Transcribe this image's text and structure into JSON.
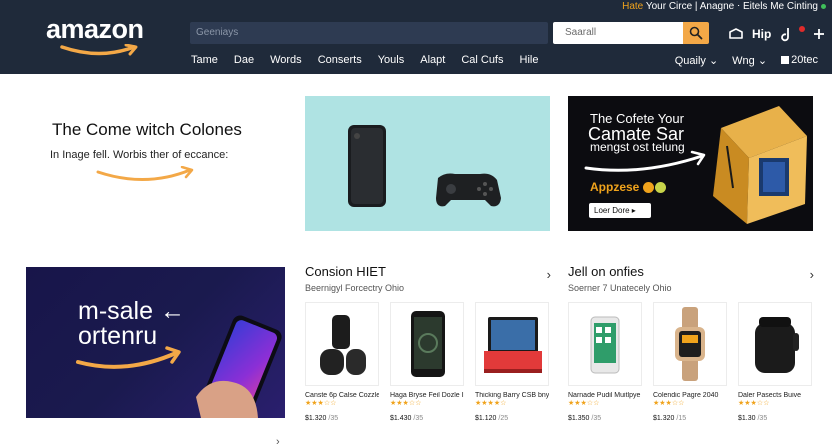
{
  "header": {
    "logo_text": "amazon",
    "top_links": {
      "highlight": "Hate",
      "rest": " Your Circe | Anagne ⋅ Eitels  Me Cinting"
    },
    "search": {
      "placeholder": "Geeniays",
      "secondary_placeholder": "Saarall"
    },
    "icons": {
      "help_label": "Hip"
    },
    "nav": [
      "Tame",
      "Dae",
      "Words",
      "Conserts",
      "Youls",
      "Alapt",
      "Cal Cufs",
      "Hile"
    ],
    "nav_right": {
      "country": "Quaily",
      "wishlist": "Wng",
      "cart": "20tec"
    }
  },
  "hero": {
    "title": "The Come witch Colones",
    "subtitle": "In Inage fell. Worbis ther of eccance:"
  },
  "dark_card": {
    "line1": "The Cofete Your",
    "line2": "Camate Sar",
    "line3": "mengst ost telung",
    "price": "Appzese",
    "cta": "Loer Dore ▸"
  },
  "promo": {
    "line1": "m-sale ←",
    "line2": "ortenru"
  },
  "sections": [
    {
      "title": "Consion HIET",
      "subtitle": "Beernigyl Forcectry Ohio",
      "products": [
        {
          "name": "Canste 6p Calse Cozzle Vizgdes",
          "stars": "★★★☆☆",
          "price": "$1.320",
          "extra": "/35"
        },
        {
          "name": "Haga Bryse Feil Dozle Iles",
          "stars": "★★★☆☆",
          "price": "$1.430",
          "extra": "/35"
        },
        {
          "name": "Thicking Barry CSB bnya",
          "stars": "★★★★☆",
          "price": "$1.120",
          "extra": "/25"
        }
      ]
    },
    {
      "title": "Jell on onfies",
      "subtitle": "Soerner 7 Unatecely Ohio",
      "products": [
        {
          "name": "Narnade Pudil Muitlpye",
          "stars": "★★★☆☆",
          "price": "$1.350",
          "extra": "/35"
        },
        {
          "name": "Colendic Pagre 2040",
          "stars": "★★★☆☆",
          "price": "$1.320",
          "extra": "/15"
        },
        {
          "name": "Daler Pasects Buive",
          "stars": "★★★☆☆",
          "price": "$1.30",
          "extra": "/35"
        }
      ]
    }
  ],
  "colors": {
    "header_bg": "#1f2a3a",
    "accent": "#f3a847",
    "cyan_card": "#afe3e3",
    "promo_bg": "#1a1a4e"
  }
}
